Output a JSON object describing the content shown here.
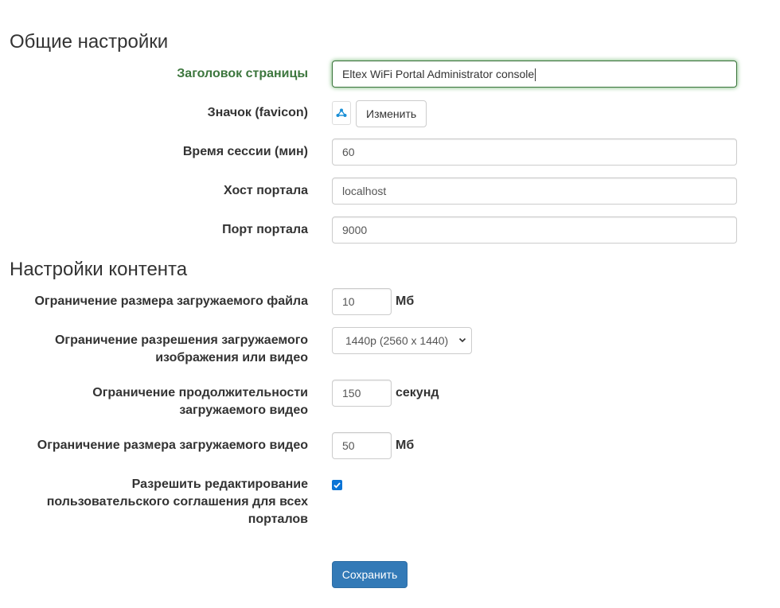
{
  "general": {
    "title": "Общие настройки",
    "page_title_label": "Заголовок страницы",
    "page_title_value": "Eltex WiFi Portal Administrator console",
    "favicon_label": "Значок (favicon)",
    "favicon_icon": "favicon-share-icon",
    "favicon_change_button": "Изменить",
    "session_label": "Время сессии (мин)",
    "session_value": "60",
    "host_label": "Хост портала",
    "host_value": "localhost",
    "port_label": "Порт портала",
    "port_value": "9000"
  },
  "content": {
    "title": "Настройки контента",
    "file_size_label": "Ограничение размера загружаемого файла",
    "file_size_value": "10",
    "file_size_unit": "Мб",
    "resolution_label_line1": "Ограничение разрешения загружаемого",
    "resolution_label_line2": "изображения или видео",
    "resolution_selected": "1440p (2560 x 1440)",
    "duration_label_line1": "Ограничение продолжительности",
    "duration_label_line2": "загружаемого видео",
    "duration_value": "150",
    "duration_unit": "секунд",
    "video_size_label": "Ограничение размера загружаемого видео",
    "video_size_value": "50",
    "video_size_unit": "Мб",
    "eula_label_line1": "Разрешить редактирование",
    "eula_label_line2": "пользовательского соглашения для всех",
    "eula_label_line3": "порталов",
    "eula_checked": true
  },
  "save_button": "Сохранить",
  "colors": {
    "success": "#3c763d",
    "primary": "#337ab7",
    "checkbox": "#0b74d6"
  }
}
